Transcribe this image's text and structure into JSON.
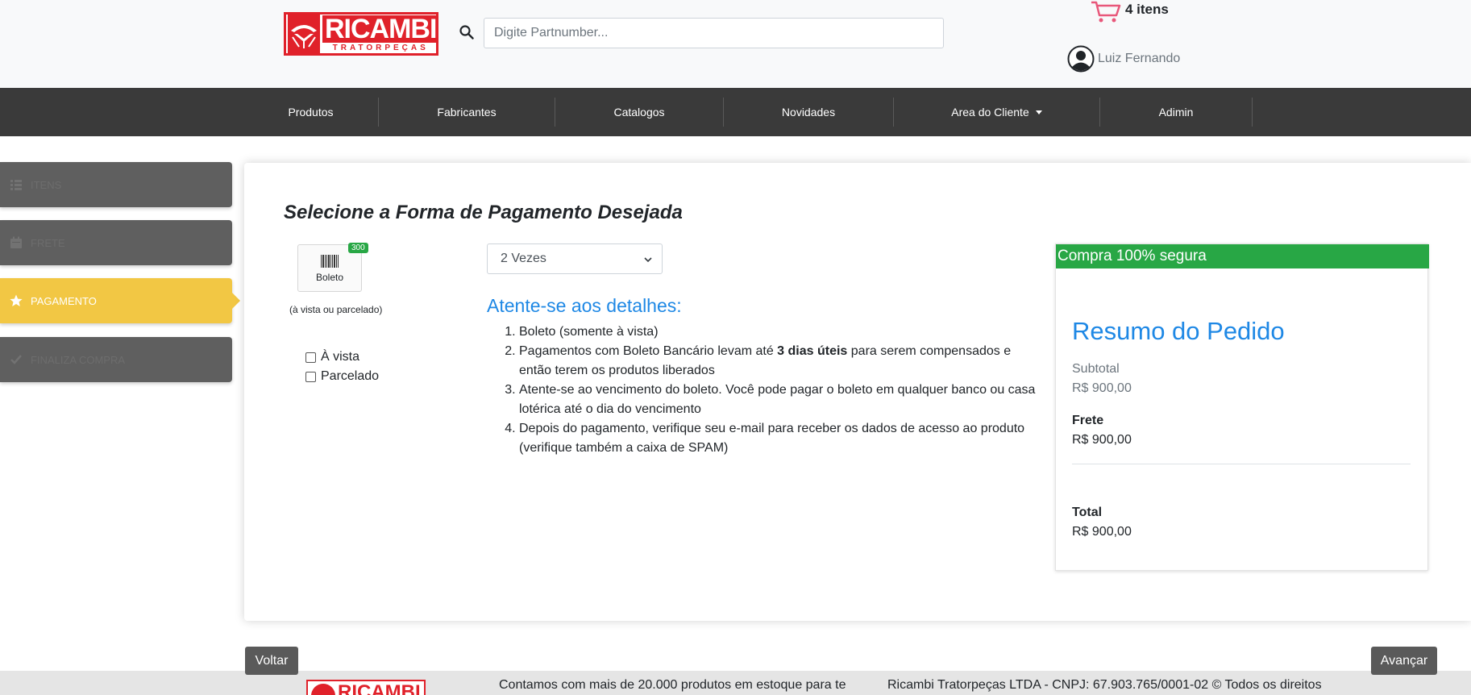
{
  "header": {
    "logo_text": "RICAMBI",
    "logo_subtext": "TRATORPEÇAS",
    "search_placeholder": "Digite Partnumber...",
    "cart_label": "4 itens",
    "user_name": "Luiz Fernando"
  },
  "nav": {
    "items": [
      {
        "label": "Produtos"
      },
      {
        "label": "Fabricantes"
      },
      {
        "label": "Catalogos"
      },
      {
        "label": "Novidades"
      },
      {
        "label": "Area do Cliente"
      },
      {
        "label": "Adimin"
      }
    ]
  },
  "steps": [
    {
      "label": "ITENS",
      "icon": "list-icon"
    },
    {
      "label": "FRETE",
      "icon": "calendar-icon"
    },
    {
      "label": "PAGAMENTO",
      "icon": "star-icon",
      "active": true
    },
    {
      "label": "FINALIZA COMPRA",
      "icon": "check-icon"
    }
  ],
  "main": {
    "title": "Selecione a Forma de Pagamento Desejada",
    "payment_option": {
      "label": "Boleto",
      "badge": "300",
      "note": "(à vista ou parcelado)"
    },
    "checkboxes": [
      {
        "label": "À vista",
        "checked": false
      },
      {
        "label": "Parcelado",
        "checked": false
      }
    ],
    "installments_select": "2 Vezes",
    "details_title": "Atente-se aos detalhes:",
    "details": {
      "item1": "Boleto (somente à vista)",
      "item2_pre": "Pagamentos com Boleto Bancário levam até ",
      "item2_bold": "3 dias úteis",
      "item2_post": " para serem compensados e então terem os produtos liberados",
      "item3": "Atente-se ao vencimento do boleto. Você pode pagar o boleto em qualquer banco ou casa lotérica até o dia do vencimento",
      "item4": "Depois do pagamento, verifique seu e-mail para receber os dados de acesso ao produto (verifique também a caixa de SPAM)"
    }
  },
  "summary": {
    "header": "Compra 100% segura",
    "title": "Resumo do Pedido",
    "subtotal_label": "Subtotal",
    "subtotal_value": "R$ 900,00",
    "frete_label": "Frete",
    "frete_value": "R$ 900,00",
    "total_label": "Total",
    "total_value": "R$ 900,00"
  },
  "buttons": {
    "back": "Voltar",
    "next": "Avançar"
  },
  "footer": {
    "logo_text": "RICAMBI",
    "text_left": "Contamos com mais de 20.000 produtos em estoque para te",
    "text_right": "Ricambi Tratorpeças LTDA - CNPJ: 67.903.765/0001-02 © Todos os direitos"
  },
  "colors": {
    "brand_red": "#e0212a",
    "nav_bg": "#3a3a3a",
    "active_step": "#f2c744",
    "accent_blue": "#1e88e5",
    "secure_green": "#28a745"
  }
}
